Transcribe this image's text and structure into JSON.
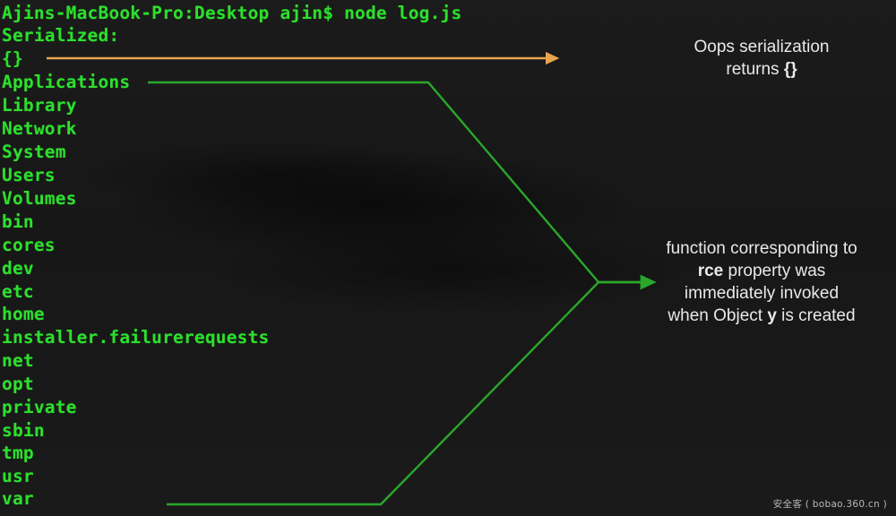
{
  "colors": {
    "background": "#181818",
    "terminal_text": "#2ddf2d",
    "green_arrow": "#2aa72a",
    "orange_arrow": "#e8a54e",
    "annotation_text": "#e9e9e9",
    "watermark_text": "#b9b9b9"
  },
  "terminal": {
    "prompt_line": "Ajins-MacBook-Pro:Desktop ajin$ node log.js",
    "label_serialized": "Serialized:",
    "serialized_value": "{}",
    "lines": [
      "Ajins-MacBook-Pro:Desktop ajin$ node log.js",
      "Serialized:",
      "{}",
      "Applications",
      "Library",
      "Network",
      "System",
      "Users",
      "Volumes",
      "bin",
      "cores",
      "dev",
      "etc",
      "home",
      "installer.failurerequests",
      "net",
      "opt",
      "private",
      "sbin",
      "tmp",
      "usr",
      "var"
    ]
  },
  "annotations": {
    "top": {
      "line1": "Oops  serialization",
      "line2_prefix": "returns ",
      "line2_code": "{}"
    },
    "right": {
      "line1": "function corresponding to",
      "line2_bold": "rce",
      "line2_rest": " property was",
      "line3": "immediately invoked",
      "line4_prefix": "when Object ",
      "line4_bold": "y",
      "line4_suffix": " is created"
    }
  },
  "watermark": {
    "text": "安全客 ( bobao.360.cn )"
  }
}
